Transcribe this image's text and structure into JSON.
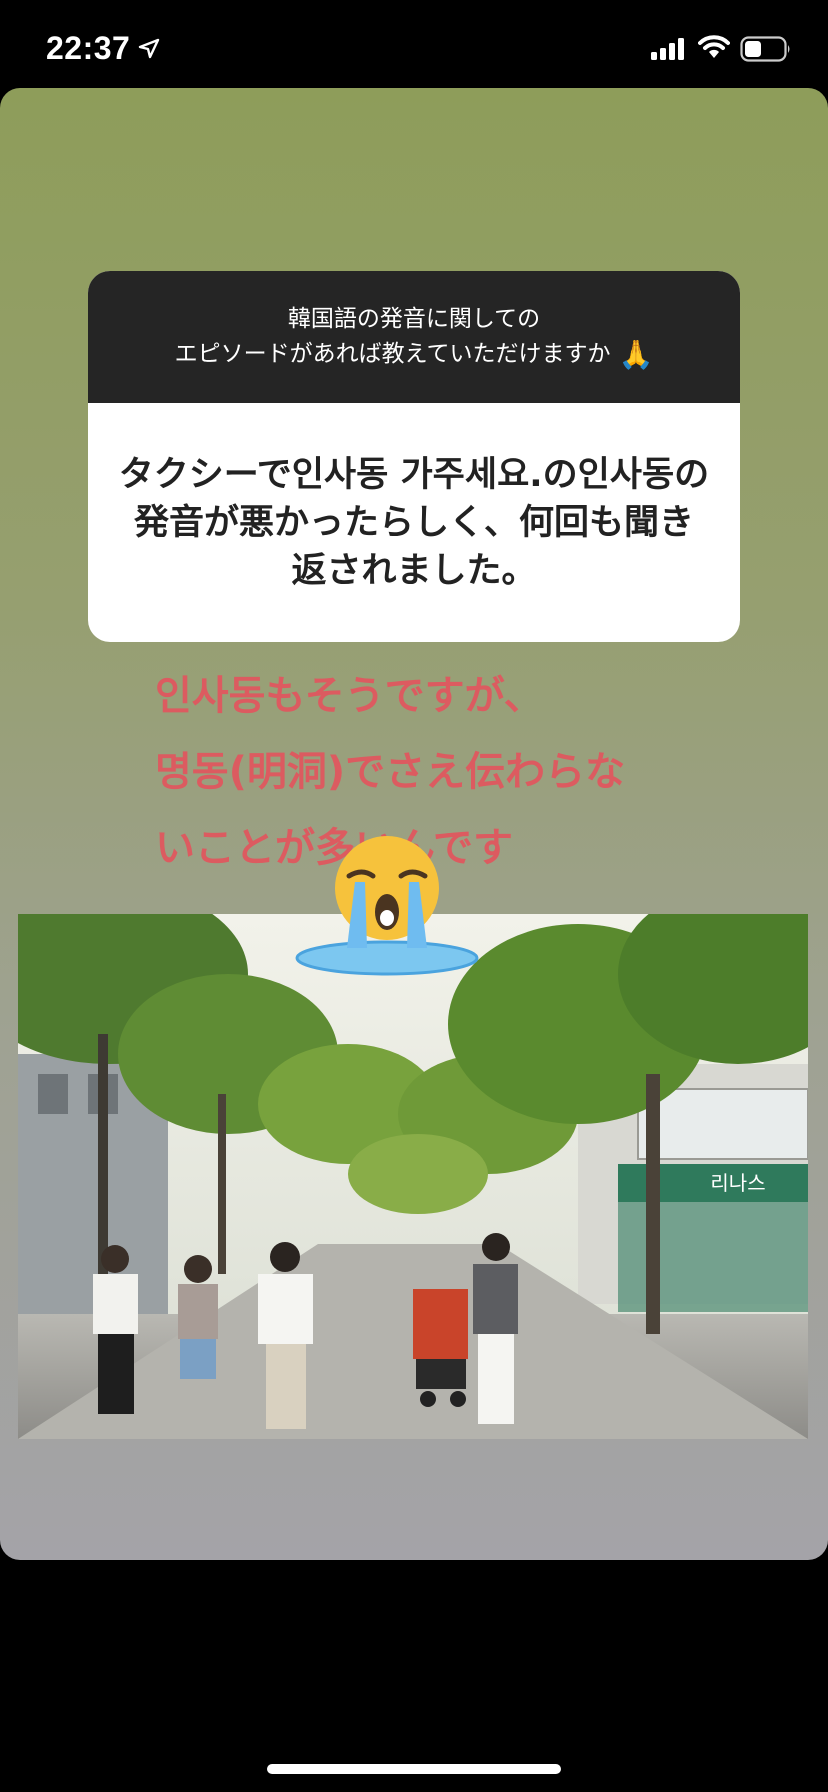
{
  "status_bar": {
    "time": "22:37",
    "icons": [
      "location-arrow-icon",
      "cellular-signal-icon",
      "wifi-icon",
      "battery-icon"
    ]
  },
  "question_sticker": {
    "question_line1": "韓国語の発音に関しての",
    "question_line2": "エピソードがあれば教えていただけますか",
    "question_emoji": "🙏",
    "answer": "タクシーで인사동 가주세요.の인사동の発音が悪かったらしく、何回も聞き返されました。"
  },
  "overlay_text": {
    "line1": "인사동もそうですが、",
    "line2": "명동(明洞)でさえ伝わらな",
    "line3": "いことが多いんです",
    "color": "#dc5b60"
  },
  "photo": {
    "description_icon": "street-scene-image",
    "sign_text": "리나스"
  },
  "sticker": {
    "icon": "crying-face-emoji-icon"
  },
  "colors": {
    "background_top": "#8e9d5a",
    "background_bottom": "#a4a3a8",
    "question_header": "#252525"
  }
}
